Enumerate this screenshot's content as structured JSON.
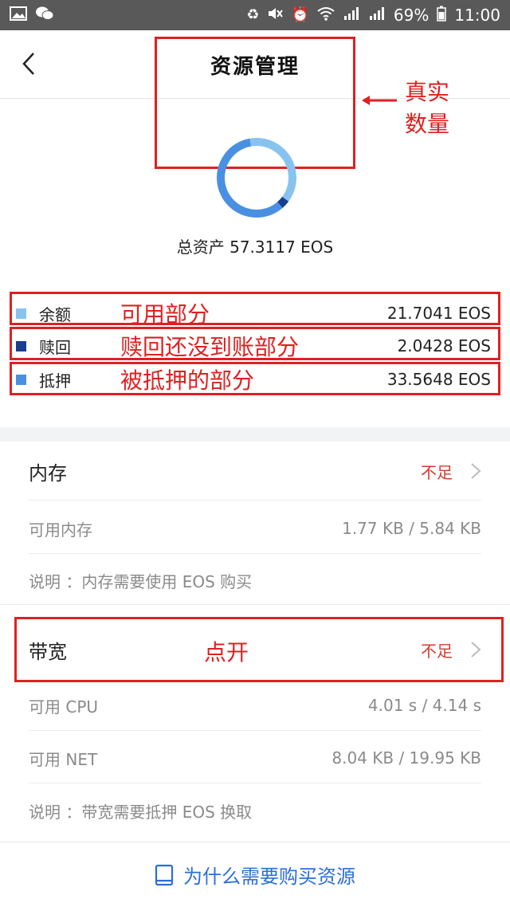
{
  "statusbar": {
    "battery": "69%",
    "time": "11:00"
  },
  "nav": {
    "title": "资源管理"
  },
  "summary": {
    "total_label": "总资产 57.3117 EOS",
    "annotation": "真实数量",
    "chart_data": {
      "type": "pie",
      "categories": [
        "余额",
        "赎回",
        "抵押"
      ],
      "values": [
        21.7041,
        2.0428,
        33.5648
      ],
      "colors": [
        "#88c3ef",
        "#1a3f8f",
        "#4a90e2"
      ]
    }
  },
  "legend": [
    {
      "label": "余额",
      "annotation": "可用部分",
      "value": "21.7041 EOS",
      "color": "#88c3ef"
    },
    {
      "label": "赎回",
      "annotation": "赎回还没到账部分",
      "value": "2.0428 EOS",
      "color": "#1a3f8f"
    },
    {
      "label": "抵押",
      "annotation": "被抵押的部分",
      "value": "33.5648 EOS",
      "color": "#4a90e2"
    }
  ],
  "memory": {
    "title": "内存",
    "status": "不足",
    "available_label": "可用内存",
    "available_value": "1.77 KB / 5.84 KB",
    "note": "说明 ：内存需要使用 EOS 购买"
  },
  "bandwidth": {
    "title": "带宽",
    "annotation": "点开",
    "status": "不足",
    "cpu_label": "可用 CPU",
    "cpu_value": "4.01 s / 4.14 s",
    "net_label": "可用 NET",
    "net_value": "8.04 KB / 19.95 KB",
    "note": "说明 ：带宽需要抵押 EOS 换取"
  },
  "footer": {
    "link": "为什么需要购买资源"
  }
}
